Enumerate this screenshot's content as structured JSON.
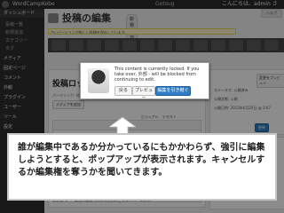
{
  "adminbar": {
    "site_name": "WordCampKobe",
    "middle_text": "Getsug",
    "user_text": "こんにちは、admin さん！"
  },
  "sidebar": {
    "dashboard": "ダッシュボード",
    "items": [
      {
        "label": "投稿一覧",
        "type": "sub"
      },
      {
        "label": "新規追加",
        "type": "sub"
      },
      {
        "label": "カテゴリー",
        "type": "sub"
      },
      {
        "label": "タグ",
        "type": "sub"
      },
      {
        "label": "メディア",
        "type": "main"
      },
      {
        "label": "固定ページ",
        "type": "main"
      },
      {
        "label": "コメント",
        "type": "main"
      },
      {
        "label": "外観",
        "type": "main"
      },
      {
        "label": "プラグイン",
        "type": "main"
      },
      {
        "label": "ユーザー",
        "type": "main"
      },
      {
        "label": "ツール",
        "type": "main"
      },
      {
        "label": "設定",
        "type": "main"
      }
    ]
  },
  "header": {
    "title": "投稿の編集",
    "new_button": "新規追加",
    "help": "ヘルプ"
  },
  "notice": "古いバージョンが新しい投稿を保存しています。",
  "post": {
    "name": "投稿ロックのテスト",
    "permalink": "パーマリンク: http://...",
    "media_button": "メディアを追加",
    "tabs": [
      "ビジュアル",
      "テキスト"
    ],
    "body_text": "本文",
    "status": "文字数: 1　　最後の編集: 2013年6月25日 3:07 PM - admin"
  },
  "publish": {
    "preview_button": "変更をプレビュー",
    "status_line": "ステータス: 公開済み",
    "visibility_line": "公開状態: 公開",
    "date_line": "公開日時: 2013年6月25日 @ 3:07",
    "update_button": "更新"
  },
  "categories": {
    "title": "カテゴリー",
    "items": [
      "未分類"
    ]
  },
  "dialog": {
    "message": "This content is currently locked. If you take over, 外部 - will be blocked from continuing to edit.",
    "back_button": "戻る",
    "preview_button": "プレビュー",
    "takeover_button": "編集を引き継ぐ"
  },
  "caption": "誰が編集中であるか分かっているにもかかわらず、強引に編集しようとすると、ポップアップが表示されます。キャンセルするか編集権を奪うかを聞いてきます。"
}
